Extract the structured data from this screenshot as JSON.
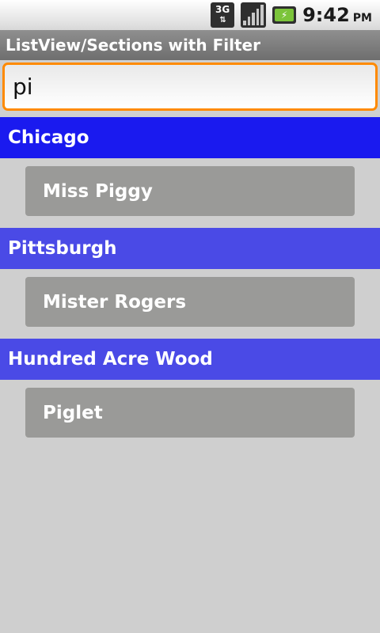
{
  "status_bar": {
    "network_type": "3G",
    "network_arrows": "⇅",
    "battery_symbol": "⚡",
    "time": "9:42",
    "ampm": "PM"
  },
  "title_bar": {
    "title": "ListView/Sections with Filter"
  },
  "search": {
    "value": "pi"
  },
  "sections": [
    {
      "header": "Chicago",
      "header_color": "#1a1aef",
      "items": [
        "Miss Piggy"
      ]
    },
    {
      "header": "Pittsburgh",
      "header_color": "#4a4ae6",
      "items": [
        "Mister Rogers"
      ]
    },
    {
      "header": "Hundred Acre Wood",
      "header_color": "#4a4ae6",
      "items": [
        "Piglet"
      ]
    }
  ]
}
